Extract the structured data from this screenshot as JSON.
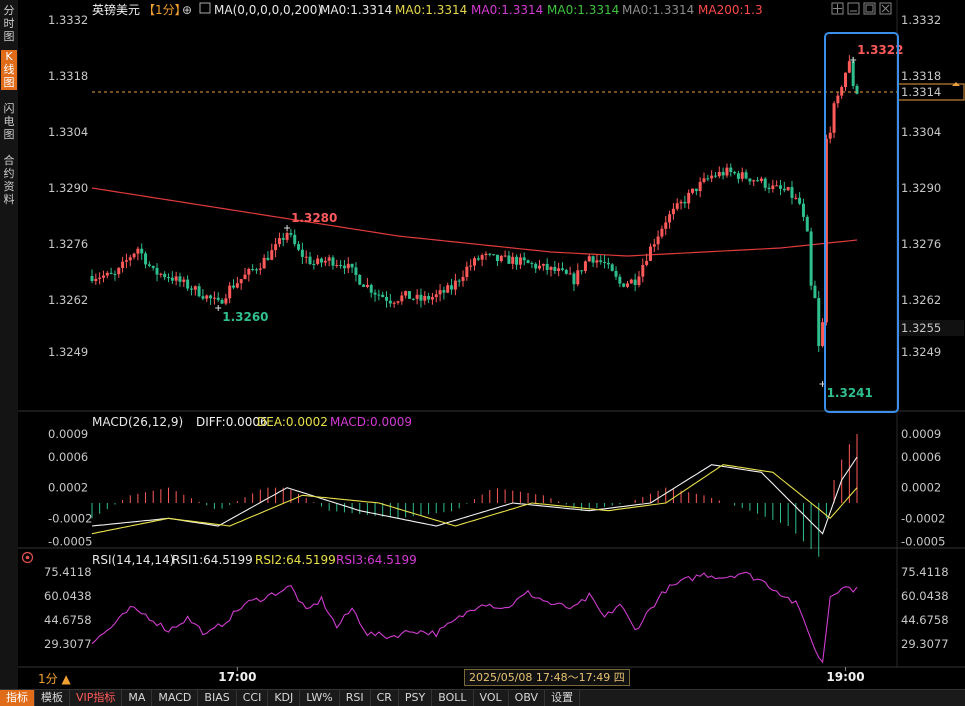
{
  "sidebar": {
    "tabs": [
      {
        "label": "分时图",
        "active": false
      },
      {
        "label": "K线图",
        "active": true
      },
      {
        "label": "闪电图",
        "active": false
      },
      {
        "label": "合约资料",
        "active": false
      }
    ]
  },
  "header": {
    "symbol": "英镑美元",
    "period": "【1分】",
    "ma_params": "MA(0,0,0,0,0,200)",
    "ma_values": [
      {
        "label": "MA0:1.3314",
        "color": "#e8e8e8"
      },
      {
        "label": "MA0:1.3314",
        "color": "#e6d84a"
      },
      {
        "label": "MA0:1.3314",
        "color": "#d43bd4"
      },
      {
        "label": "MA0:1.3314",
        "color": "#3ec43e"
      },
      {
        "label": "MA0:1.3314",
        "color": "#8c8c8c"
      },
      {
        "label": "MA200:1.3",
        "color": "#ff4a4a"
      }
    ]
  },
  "macd_legend": {
    "params": "MACD(26,12,9)",
    "diff": "DIFF:0.0006",
    "dea": "DEA:0.0002",
    "macd": "MACD:0.0009"
  },
  "rsi_legend": {
    "params": "RSI(14,14,14)",
    "rsi1": "RSI1:64.5199",
    "rsi2": "RSI2:64.5199",
    "rsi3": "RSI3:64.5199"
  },
  "bottom": {
    "period_label": "1分 ▲",
    "time_range": "2025/05/08 17:48～17:49 四",
    "tabs": [
      {
        "label": "指标",
        "active": true
      },
      {
        "label": "模板"
      },
      {
        "label": "VIP指标",
        "vip": true
      },
      {
        "label": "MA"
      },
      {
        "label": "MACD"
      },
      {
        "label": "BIAS"
      },
      {
        "label": "CCI"
      },
      {
        "label": "KDJ"
      },
      {
        "label": "LW%"
      },
      {
        "label": "RSI"
      },
      {
        "label": "CR"
      },
      {
        "label": "PSY"
      },
      {
        "label": "BOLL"
      },
      {
        "label": "VOL"
      },
      {
        "label": "OBV"
      },
      {
        "label": "设置"
      }
    ]
  },
  "colors": {
    "up": "#ff5a5a",
    "down": "#2fbf8f",
    "ma200": "#e03a3a",
    "diff": "#f2f2f2",
    "dea": "#e8e04a",
    "rsi": "#d03cd0",
    "highlight_box": "#3a8fe8",
    "current_price_line": "#e8a040"
  },
  "chart_data": [
    {
      "type": "candlestick",
      "title": "英镑美元【1分】",
      "yticks": [
        "1.3332",
        "1.3318",
        "1.3304",
        "1.3290",
        "1.3276",
        "1.3262",
        "1.3249"
      ],
      "ylim": [
        1.3237,
        1.3336
      ],
      "xticks": [
        {
          "i": 38,
          "label": "17:00"
        },
        {
          "i": 197,
          "label": "19:00"
        }
      ],
      "current_price": "1.3314",
      "marker_price": "1.3255",
      "annotations": [
        {
          "label": "1.3280",
          "i": 51,
          "price": 1.328,
          "color": "up"
        },
        {
          "label": "1.3260",
          "i": 33,
          "price": 1.326,
          "color": "down"
        },
        {
          "label": "1.3322",
          "i": 199,
          "price": 1.3322,
          "color": "up"
        },
        {
          "label": "1.3241",
          "i": 191,
          "price": 1.3241,
          "color": "down"
        }
      ],
      "close_path": [
        [
          0,
          1.3268
        ],
        [
          6,
          1.3268
        ],
        [
          10,
          1.3273
        ],
        [
          12,
          1.3275
        ],
        [
          16,
          1.3269
        ],
        [
          20,
          1.3268
        ],
        [
          24,
          1.3266
        ],
        [
          28,
          1.3264
        ],
        [
          33,
          1.3261
        ],
        [
          36,
          1.3265
        ],
        [
          40,
          1.3268
        ],
        [
          44,
          1.3271
        ],
        [
          48,
          1.3275
        ],
        [
          51,
          1.3279
        ],
        [
          54,
          1.3274
        ],
        [
          58,
          1.3271
        ],
        [
          62,
          1.3272
        ],
        [
          66,
          1.3271
        ],
        [
          70,
          1.3267
        ],
        [
          74,
          1.3264
        ],
        [
          78,
          1.3262
        ],
        [
          82,
          1.3263
        ],
        [
          86,
          1.3262
        ],
        [
          90,
          1.3263
        ],
        [
          94,
          1.3265
        ],
        [
          98,
          1.327
        ],
        [
          102,
          1.3273
        ],
        [
          106,
          1.3272
        ],
        [
          110,
          1.3272
        ],
        [
          114,
          1.3271
        ],
        [
          118,
          1.327
        ],
        [
          122,
          1.3269
        ],
        [
          126,
          1.3267
        ],
        [
          130,
          1.3273
        ],
        [
          134,
          1.3271
        ],
        [
          138,
          1.3266
        ],
        [
          142,
          1.3267
        ],
        [
          146,
          1.3275
        ],
        [
          150,
          1.3282
        ],
        [
          154,
          1.3286
        ],
        [
          158,
          1.329
        ],
        [
          162,
          1.3293
        ],
        [
          166,
          1.3294
        ],
        [
          170,
          1.3293
        ],
        [
          174,
          1.3292
        ],
        [
          178,
          1.329
        ],
        [
          182,
          1.3289
        ],
        [
          185,
          1.3286
        ],
        [
          187,
          1.3278
        ],
        [
          188,
          1.3265
        ],
        [
          189,
          1.3262
        ],
        [
          190,
          1.325
        ],
        [
          191,
          1.3256
        ],
        [
          192,
          1.3302
        ],
        [
          193,
          1.3305
        ],
        [
          194,
          1.331
        ],
        [
          195,
          1.3312
        ],
        [
          196,
          1.3316
        ],
        [
          197,
          1.3319
        ],
        [
          198,
          1.3321
        ],
        [
          199,
          1.3316
        ],
        [
          200,
          1.3314
        ]
      ],
      "ma200_path": [
        [
          0,
          1.329
        ],
        [
          20,
          1.3287
        ],
        [
          40,
          1.3284
        ],
        [
          60,
          1.3281
        ],
        [
          80,
          1.3278
        ],
        [
          100,
          1.3276
        ],
        [
          120,
          1.3274
        ],
        [
          140,
          1.3273
        ],
        [
          160,
          1.3274
        ],
        [
          180,
          1.3275
        ],
        [
          200,
          1.3277
        ]
      ]
    },
    {
      "type": "line",
      "title": "MACD(26,12,9)",
      "yticks": [
        "0.0009",
        "0.0006",
        "0.0002",
        "-0.0002",
        "-0.0005"
      ],
      "ylim": [
        -0.00075,
        0.001
      ],
      "series": [
        {
          "name": "DIFF",
          "color": "diff",
          "points": [
            [
              0,
              -0.0003
            ],
            [
              20,
              -0.0002
            ],
            [
              33,
              -0.0003
            ],
            [
              51,
              0.0002
            ],
            [
              70,
              -0.0001
            ],
            [
              90,
              -0.0003
            ],
            [
              110,
              0.0
            ],
            [
              130,
              -0.0001
            ],
            [
              146,
              0.0
            ],
            [
              162,
              0.0005
            ],
            [
              175,
              0.0004
            ],
            [
              185,
              -0.0001
            ],
            [
              191,
              -0.0004
            ],
            [
              196,
              0.0003
            ],
            [
              200,
              0.0006
            ]
          ]
        },
        {
          "name": "DEA",
          "color": "dea",
          "points": [
            [
              0,
              -0.0004
            ],
            [
              20,
              -0.0002
            ],
            [
              36,
              -0.0003
            ],
            [
              55,
              0.0001
            ],
            [
              75,
              0.0
            ],
            [
              95,
              -0.0003
            ],
            [
              115,
              0.0
            ],
            [
              135,
              -0.0001
            ],
            [
              150,
              0.0
            ],
            [
              165,
              0.0005
            ],
            [
              178,
              0.0004
            ],
            [
              188,
              0.0
            ],
            [
              193,
              -0.0002
            ],
            [
              200,
              0.0002
            ]
          ]
        }
      ],
      "bars": {
        "name": "MACD",
        "points": [
          [
            0,
            -0.0002
          ],
          [
            10,
            0.0001
          ],
          [
            20,
            0.0002
          ],
          [
            33,
            -0.0001
          ],
          [
            45,
            0.0002
          ],
          [
            51,
            0.0002
          ],
          [
            62,
            -0.0001
          ],
          [
            80,
            -0.0002
          ],
          [
            95,
            -0.0001
          ],
          [
            105,
            0.0002
          ],
          [
            118,
            0.0001
          ],
          [
            128,
            -0.0001
          ],
          [
            140,
            0.0
          ],
          [
            150,
            0.0002
          ],
          [
            160,
            0.0001
          ],
          [
            172,
            -0.0001
          ],
          [
            182,
            -0.0003
          ],
          [
            190,
            -0.0007
          ],
          [
            194,
            0.0003
          ],
          [
            197,
            0.0007
          ],
          [
            200,
            0.0009
          ]
        ]
      }
    },
    {
      "type": "line",
      "title": "RSI(14,14,14)",
      "yticks": [
        "75.4118",
        "60.0438",
        "44.6758",
        "29.3077"
      ],
      "ylim": [
        14,
        77
      ],
      "series": [
        {
          "name": "RSI1",
          "color": "rsi",
          "points": [
            [
              0,
              30
            ],
            [
              6,
              42
            ],
            [
              10,
              52
            ],
            [
              14,
              48
            ],
            [
              20,
              38
            ],
            [
              25,
              46
            ],
            [
              30,
              35
            ],
            [
              35,
              44
            ],
            [
              40,
              55
            ],
            [
              46,
              60
            ],
            [
              52,
              66
            ],
            [
              56,
              50
            ],
            [
              60,
              58
            ],
            [
              64,
              40
            ],
            [
              68,
              52
            ],
            [
              72,
              36
            ],
            [
              78,
              34
            ],
            [
              84,
              38
            ],
            [
              90,
              36
            ],
            [
              96,
              46
            ],
            [
              102,
              56
            ],
            [
              108,
              52
            ],
            [
              114,
              62
            ],
            [
              120,
              55
            ],
            [
              126,
              52
            ],
            [
              130,
              60
            ],
            [
              134,
              46
            ],
            [
              138,
              55
            ],
            [
              142,
              38
            ],
            [
              146,
              52
            ],
            [
              150,
              64
            ],
            [
              155,
              70
            ],
            [
              160,
              74
            ],
            [
              165,
              72
            ],
            [
              170,
              75
            ],
            [
              175,
              70
            ],
            [
              180,
              62
            ],
            [
              184,
              55
            ],
            [
              187,
              40
            ],
            [
              189,
              25
            ],
            [
              191,
              18
            ],
            [
              193,
              60
            ],
            [
              196,
              66
            ],
            [
              200,
              64
            ]
          ]
        }
      ]
    }
  ]
}
